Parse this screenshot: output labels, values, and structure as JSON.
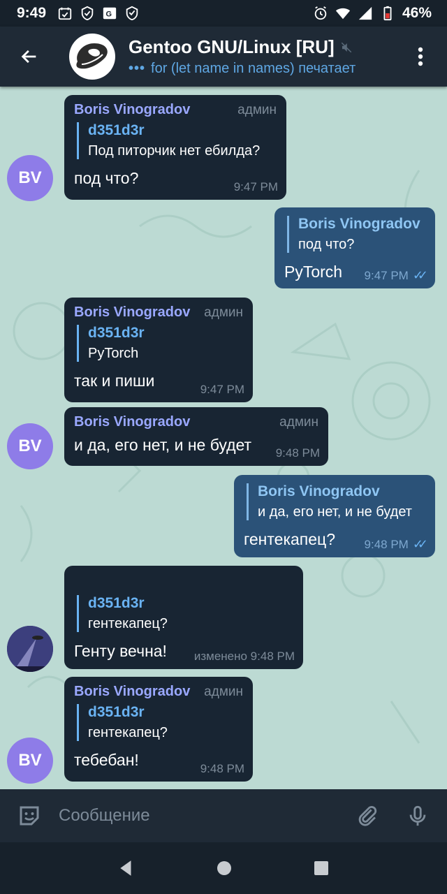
{
  "status": {
    "time": "9:49",
    "battery": "46%",
    "icons": [
      "calendar-check-icon",
      "shield-check-icon",
      "translate-icon",
      "shield-icon"
    ],
    "right_icons": [
      "alarm-icon",
      "wifi-icon",
      "signal-icon",
      "battery-icon"
    ]
  },
  "header": {
    "title": "Gentoo GNU/Linux [RU]",
    "subtitle": "for (let name in names) печатает",
    "muted_icon": "mute-icon"
  },
  "messages": [
    {
      "sender": "Boris Vinogradov",
      "role": "админ",
      "reply_name": "d351d3r",
      "reply_text": "Под питорчик нет ебилда?",
      "text": "под что?",
      "time": "9:47 PM",
      "avatar": "BV"
    },
    {
      "reply_name": "Boris Vinogradov",
      "reply_text": "под что?",
      "text": "PyTorch",
      "time": "9:47 PM"
    },
    {
      "sender": "Boris Vinogradov",
      "role": "админ",
      "reply_name": "d351d3r",
      "reply_text": "PyTorch",
      "text": "так и пиши",
      "time": "9:47 PM"
    },
    {
      "sender": "Boris Vinogradov",
      "role": "админ",
      "text": "и да, его нет, и не будет",
      "time": "9:48 PM",
      "avatar": "BV"
    },
    {
      "reply_name": "Boris Vinogradov",
      "reply_text": "и да, его нет, и не будет",
      "text": "гентекапец?",
      "time": "9:48 PM"
    },
    {
      "reply_name": "d351d3r",
      "reply_text": "гентекапец?",
      "text": "Генту вечна!",
      "time": "изменено 9:48 PM"
    },
    {
      "sender": "Boris Vinogradov",
      "role": "админ",
      "reply_name": "d351d3r",
      "reply_text": "гентекапец?",
      "text": "тебебан!",
      "time": "9:48 PM",
      "avatar": "BV"
    }
  ],
  "input": {
    "placeholder": "Сообщение"
  },
  "colors": {
    "incoming": "#182533",
    "outgoing": "#2b5278",
    "background": "#bcdad3",
    "accent": "#6ab3f3",
    "sender": "#9aa8ff"
  }
}
